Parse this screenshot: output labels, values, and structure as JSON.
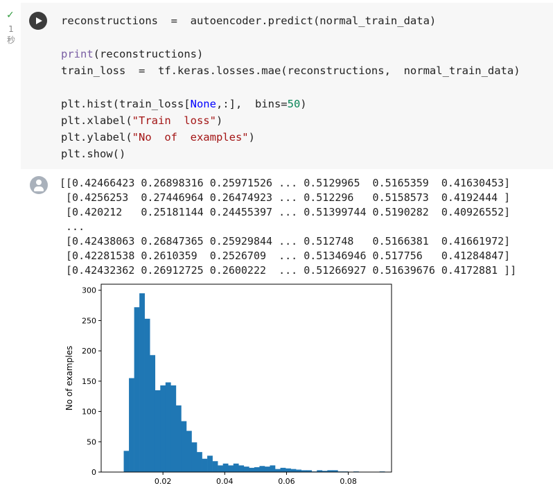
{
  "cell": {
    "status_icon": "check-icon",
    "exec_time": [
      "1",
      "秒"
    ],
    "run_button_icon": "play-icon",
    "code_lines": [
      [
        {
          "t": "reconstructions  =  autoencoder.predict(normal_train_data)",
          "c": ""
        }
      ],
      [],
      [
        {
          "t": "print",
          "c": "kw"
        },
        {
          "t": "(reconstructions)",
          "c": ""
        }
      ],
      [
        {
          "t": "train_loss  =  tf.keras.losses.mae(reconstructions,  normal_train_data)",
          "c": ""
        }
      ],
      [],
      [
        {
          "t": "plt.hist(train_loss[",
          "c": ""
        },
        {
          "t": "None",
          "c": "blue"
        },
        {
          "t": ",:],  bins=",
          "c": ""
        },
        {
          "t": "50",
          "c": "num"
        },
        {
          "t": ")",
          "c": ""
        }
      ],
      [
        {
          "t": "plt.xlabel(",
          "c": ""
        },
        {
          "t": "\"Train  loss\"",
          "c": "str"
        },
        {
          "t": ")",
          "c": ""
        }
      ],
      [
        {
          "t": "plt.ylabel(",
          "c": ""
        },
        {
          "t": "\"No  of  examples\"",
          "c": "str"
        },
        {
          "t": ")",
          "c": ""
        }
      ],
      [
        {
          "t": "plt.show()",
          "c": ""
        }
      ]
    ]
  },
  "output": {
    "icon": "user-avatar-icon",
    "array_lines": [
      "[[0.42466423 0.26898316 0.25971526 ... 0.5129965  0.5165359  0.41630453]",
      " [0.4256253  0.27446964 0.26474923 ... 0.512296   0.5158573  0.4192444 ]",
      " [0.420212   0.25181144 0.24455397 ... 0.51399744 0.5190282  0.40926552]",
      " ...",
      " [0.42438063 0.26847365 0.25929844 ... 0.512748   0.5166381  0.41661972]",
      " [0.42281538 0.2610359  0.2526709  ... 0.51346946 0.517756   0.41284847]",
      " [0.42432362 0.26912725 0.2600222  ... 0.51266927 0.51639676 0.4172881 ]]"
    ]
  },
  "chart_data": {
    "type": "bar",
    "title": "",
    "xlabel": "",
    "ylabel": "No of examples",
    "xlim": [
      0.0,
      0.094
    ],
    "ylim": [
      0,
      310
    ],
    "x_ticks": [
      0.02,
      0.04,
      0.06,
      0.08
    ],
    "x_tick_labels": [
      "0.02",
      "0.04",
      "0.06",
      "0.08"
    ],
    "y_ticks": [
      0,
      50,
      100,
      150,
      200,
      250,
      300
    ],
    "y_tick_labels": [
      "0",
      "50",
      "100",
      "150",
      "200",
      "250",
      "300"
    ],
    "bar_color": "#1f77b4",
    "bin_start": 0.0073,
    "bin_width": 0.00169,
    "values": [
      35,
      155,
      272,
      295,
      253,
      193,
      135,
      143,
      148,
      143,
      110,
      84,
      68,
      49,
      33,
      22,
      27,
      18,
      11,
      14,
      11,
      14,
      11,
      9,
      7,
      8,
      10,
      9,
      11,
      5,
      7,
      6,
      5,
      4,
      3,
      3,
      1,
      3,
      2,
      3,
      3,
      1,
      1,
      0,
      1,
      0,
      0,
      0,
      0,
      1
    ]
  }
}
